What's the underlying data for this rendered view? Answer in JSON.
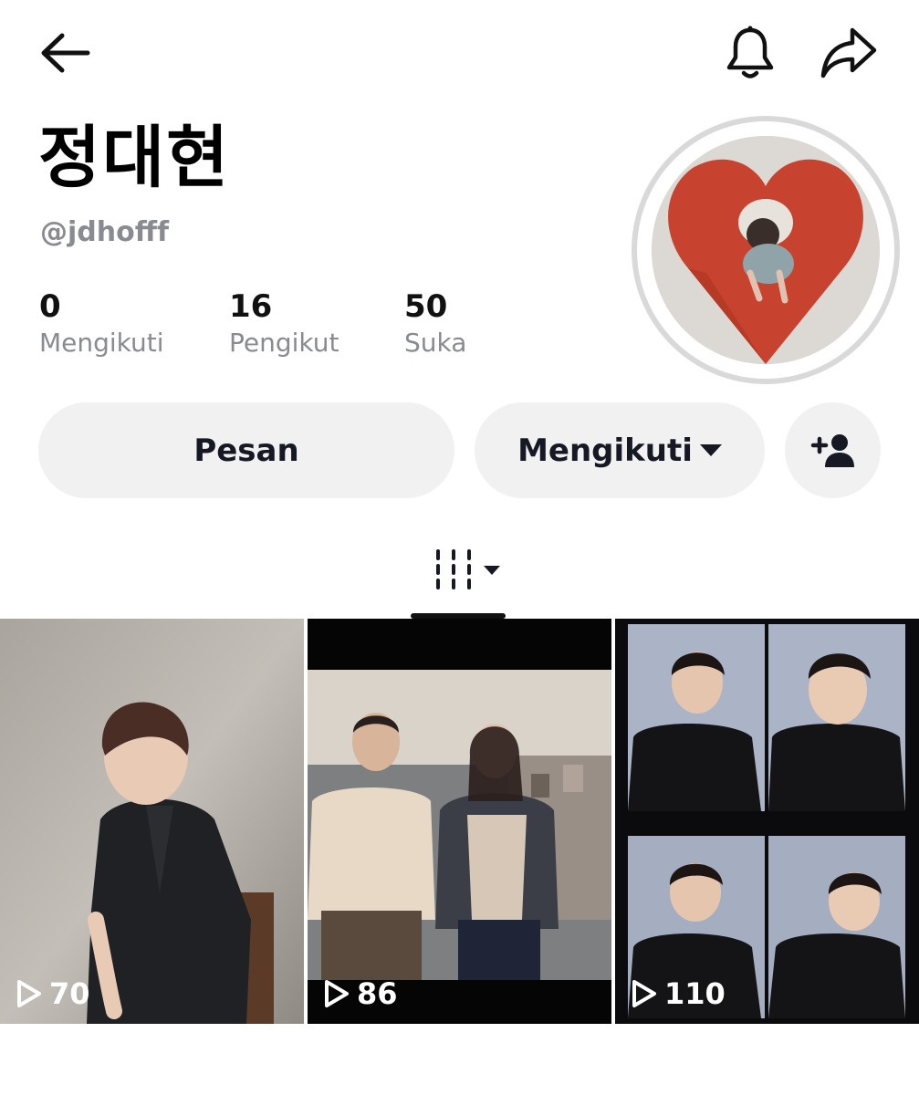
{
  "profile": {
    "display_name": "정대현",
    "username": "@jdhofff",
    "stats": {
      "following": {
        "value": "0",
        "label": "Mengikuti"
      },
      "followers": {
        "value": "16",
        "label": "Pengikut"
      },
      "likes": {
        "value": "50",
        "label": "Suka"
      }
    }
  },
  "actions": {
    "message_label": "Pesan",
    "follow_label": "Mengikuti"
  },
  "icons": {
    "back": "back-arrow-icon",
    "bell": "bell-icon",
    "share": "share-icon",
    "add_friend": "add-user-icon",
    "grid": "grid-icon",
    "play": "play-icon"
  },
  "videos": [
    {
      "views": "70"
    },
    {
      "views": "86"
    },
    {
      "views": "110"
    }
  ]
}
